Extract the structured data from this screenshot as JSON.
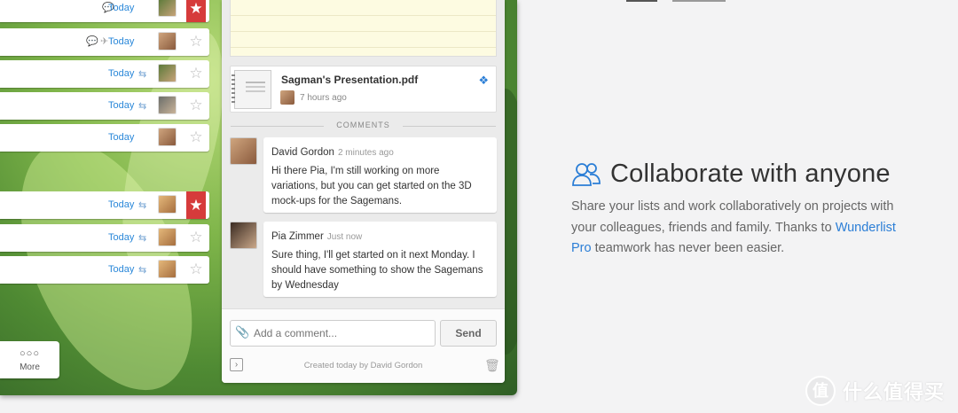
{
  "tasks": [
    {
      "date": "Today",
      "has_comment": true,
      "has_pin": false,
      "recurring": false,
      "starred": true,
      "avatar": "av1"
    },
    {
      "date": "Today",
      "has_comment": true,
      "has_pin": true,
      "recurring": false,
      "starred": false,
      "avatar": "av2"
    },
    {
      "date": "Today",
      "has_comment": false,
      "has_pin": false,
      "recurring": true,
      "starred": false,
      "avatar": "av1"
    },
    {
      "date": "Today",
      "has_comment": false,
      "has_pin": false,
      "recurring": true,
      "starred": false,
      "avatar": "av3"
    },
    {
      "date": "Today",
      "has_comment": false,
      "has_pin": false,
      "recurring": false,
      "starred": false,
      "avatar": "av2"
    },
    {
      "date": "Today",
      "has_comment": false,
      "has_pin": false,
      "recurring": true,
      "starred": true,
      "avatar": "av4"
    },
    {
      "date": "Today",
      "has_comment": false,
      "has_pin": false,
      "recurring": true,
      "starred": false,
      "avatar": "av4"
    },
    {
      "date": "Today",
      "has_comment": false,
      "has_pin": false,
      "recurring": true,
      "starred": false,
      "avatar": "av4"
    }
  ],
  "more_button": {
    "label": "More"
  },
  "detail": {
    "file": {
      "name": "Sagman's Presentation.pdf",
      "time": "7 hours ago"
    },
    "comments_heading": "COMMENTS",
    "comments": [
      {
        "author": "David Gordon",
        "time": "2 minutes ago",
        "body": "Hi there Pia, I'm still working on more variations, but you can get started on the 3D mock-ups for the Sagemans."
      },
      {
        "author": "Pia Zimmer",
        "time": "Just now",
        "body": "Sure thing, I'll get started on it next Monday. I should have something to show the Sagemans by Wednesday"
      }
    ],
    "comment_input": {
      "placeholder": "Add a comment..."
    },
    "send_label": "Send",
    "created_text": "Created today by David Gordon"
  },
  "feature": {
    "title": "Collaborate with anyone",
    "desc_before": "Share your lists and work collaboratively on projects with your colleagues, friends and family. Thanks to ",
    "desc_link": "Wunderlist Pro",
    "desc_after": " teamwork has never been easier."
  },
  "watermark": {
    "badge": "值",
    "text": "什么值得买"
  },
  "colors": {
    "accent": "#2b7ed6",
    "star_red": "#d63b3b",
    "note_yellow": "#fdfbe1"
  }
}
